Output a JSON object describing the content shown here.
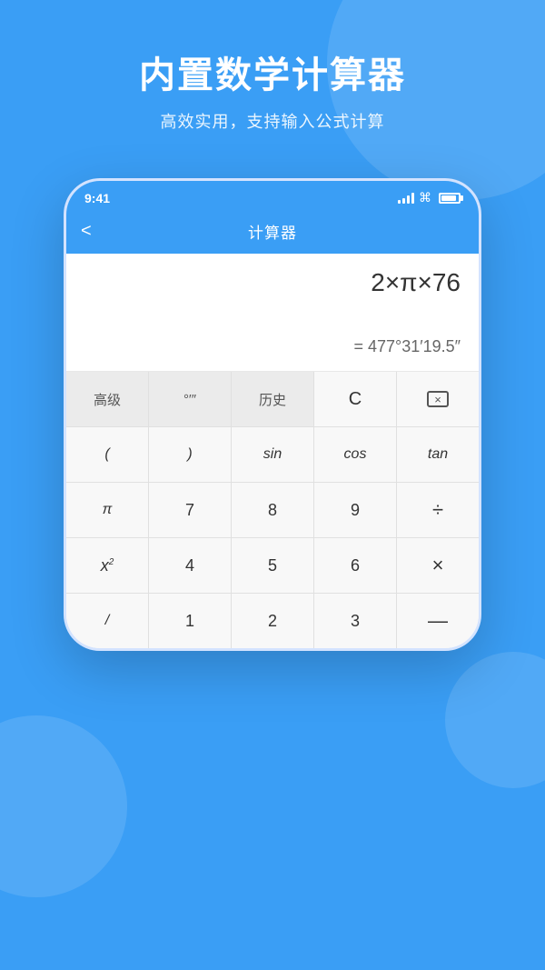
{
  "header": {
    "main_title": "内置数学计算器",
    "sub_title": "高效实用，支持输入公式计算"
  },
  "phone": {
    "status_bar": {
      "time": "9:41",
      "signal_level": 4,
      "wifi": true,
      "battery": 80
    },
    "app_header": {
      "back_label": "<",
      "title": "计算器"
    },
    "display": {
      "input": "2×π×76",
      "result": "= 477°31′19.5″"
    },
    "keyboard": {
      "rows": [
        [
          {
            "label": "高级",
            "type": "gray"
          },
          {
            "label": "°′″",
            "type": "gray"
          },
          {
            "label": "历史",
            "type": "gray"
          },
          {
            "label": "C",
            "type": "clear"
          },
          {
            "label": "⌫",
            "type": "delete"
          }
        ],
        [
          {
            "label": "(",
            "type": "func"
          },
          {
            "label": ")",
            "type": "func"
          },
          {
            "label": "sin",
            "type": "func"
          },
          {
            "label": "cos",
            "type": "func"
          },
          {
            "label": "tan",
            "type": "func"
          }
        ],
        [
          {
            "label": "π",
            "type": "func"
          },
          {
            "label": "7",
            "type": "num"
          },
          {
            "label": "8",
            "type": "num"
          },
          {
            "label": "9",
            "type": "num"
          },
          {
            "label": "÷",
            "type": "operator"
          }
        ],
        [
          {
            "label": "x²",
            "type": "superscript"
          },
          {
            "label": "4",
            "type": "num"
          },
          {
            "label": "5",
            "type": "num"
          },
          {
            "label": "6",
            "type": "num"
          },
          {
            "label": "×",
            "type": "operator"
          }
        ],
        [
          {
            "label": "/",
            "type": "func"
          },
          {
            "label": "1",
            "type": "num"
          },
          {
            "label": "2",
            "type": "num"
          },
          {
            "label": "3",
            "type": "num"
          },
          {
            "label": "—",
            "type": "operator"
          }
        ]
      ]
    }
  }
}
